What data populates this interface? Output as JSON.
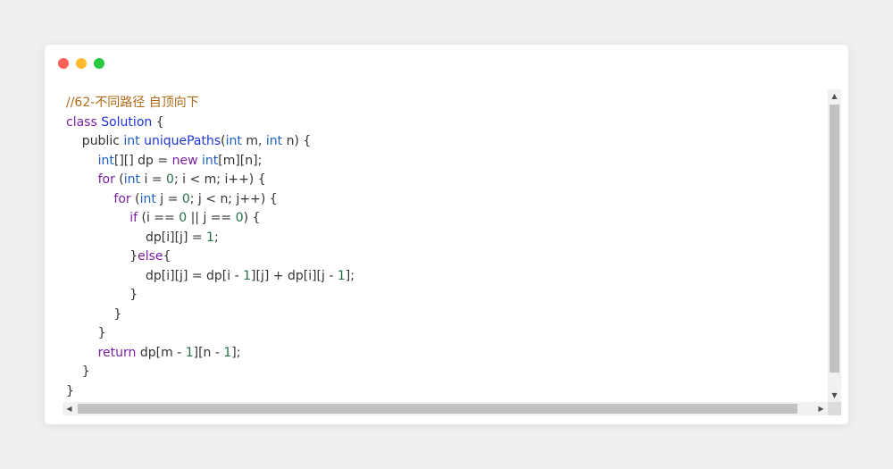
{
  "window": {
    "controls": [
      {
        "name": "close",
        "color": "#ff5f57"
      },
      {
        "name": "minimize",
        "color": "#febc2e"
      },
      {
        "name": "maximize",
        "color": "#28c840"
      }
    ]
  },
  "scrollbars": {
    "up_arrow": "▲",
    "down_arrow": "▼",
    "left_arrow": "◀",
    "right_arrow": "▶"
  },
  "code": {
    "lines": [
      [
        {
          "t": "//62-不同路径 自顶向下",
          "k": "comment"
        }
      ],
      [
        {
          "t": "class",
          "k": "keyword"
        },
        {
          "t": " ",
          "k": "default"
        },
        {
          "t": "Solution",
          "k": "class"
        },
        {
          "t": " {",
          "k": "default"
        }
      ],
      [
        {
          "t": "    public ",
          "k": "default"
        },
        {
          "t": "int",
          "k": "type"
        },
        {
          "t": " ",
          "k": "default"
        },
        {
          "t": "uniquePaths",
          "k": "method"
        },
        {
          "t": "(",
          "k": "default"
        },
        {
          "t": "int",
          "k": "type"
        },
        {
          "t": " m, ",
          "k": "default"
        },
        {
          "t": "int",
          "k": "type"
        },
        {
          "t": " n) {",
          "k": "default"
        }
      ],
      [
        {
          "t": "        ",
          "k": "default"
        },
        {
          "t": "int",
          "k": "type"
        },
        {
          "t": "[][] dp = ",
          "k": "default"
        },
        {
          "t": "new",
          "k": "keyword"
        },
        {
          "t": " ",
          "k": "default"
        },
        {
          "t": "int",
          "k": "type"
        },
        {
          "t": "[m][n];",
          "k": "default"
        }
      ],
      [
        {
          "t": "        ",
          "k": "default"
        },
        {
          "t": "for",
          "k": "keyword"
        },
        {
          "t": " (",
          "k": "default"
        },
        {
          "t": "int",
          "k": "type"
        },
        {
          "t": " i = ",
          "k": "default"
        },
        {
          "t": "0",
          "k": "number"
        },
        {
          "t": "; i < m; i++) {",
          "k": "default"
        }
      ],
      [
        {
          "t": "            ",
          "k": "default"
        },
        {
          "t": "for",
          "k": "keyword"
        },
        {
          "t": " (",
          "k": "default"
        },
        {
          "t": "int",
          "k": "type"
        },
        {
          "t": " j = ",
          "k": "default"
        },
        {
          "t": "0",
          "k": "number"
        },
        {
          "t": "; j < n; j++) {",
          "k": "default"
        }
      ],
      [
        {
          "t": "                ",
          "k": "default"
        },
        {
          "t": "if",
          "k": "keyword"
        },
        {
          "t": " (i == ",
          "k": "default"
        },
        {
          "t": "0",
          "k": "number"
        },
        {
          "t": " || j == ",
          "k": "default"
        },
        {
          "t": "0",
          "k": "number"
        },
        {
          "t": ") {",
          "k": "default"
        }
      ],
      [
        {
          "t": "                    dp[i][j] = ",
          "k": "default"
        },
        {
          "t": "1",
          "k": "number"
        },
        {
          "t": ";",
          "k": "default"
        }
      ],
      [
        {
          "t": "                }",
          "k": "default"
        },
        {
          "t": "else",
          "k": "keyword"
        },
        {
          "t": "{",
          "k": "default"
        }
      ],
      [
        {
          "t": "                    dp[i][j] = dp[i - ",
          "k": "default"
        },
        {
          "t": "1",
          "k": "number"
        },
        {
          "t": "][j] + dp[i][j - ",
          "k": "default"
        },
        {
          "t": "1",
          "k": "number"
        },
        {
          "t": "];",
          "k": "default"
        }
      ],
      [
        {
          "t": "                }",
          "k": "default"
        }
      ],
      [
        {
          "t": "            }",
          "k": "default"
        }
      ],
      [
        {
          "t": "        }",
          "k": "default"
        }
      ],
      [
        {
          "t": "        ",
          "k": "default"
        },
        {
          "t": "return",
          "k": "keyword"
        },
        {
          "t": " dp[m - ",
          "k": "default"
        },
        {
          "t": "1",
          "k": "number"
        },
        {
          "t": "][n - ",
          "k": "default"
        },
        {
          "t": "1",
          "k": "number"
        },
        {
          "t": "];",
          "k": "default"
        }
      ],
      [
        {
          "t": "    }",
          "k": "default"
        }
      ],
      [
        {
          "t": "}",
          "k": "default"
        }
      ]
    ]
  }
}
